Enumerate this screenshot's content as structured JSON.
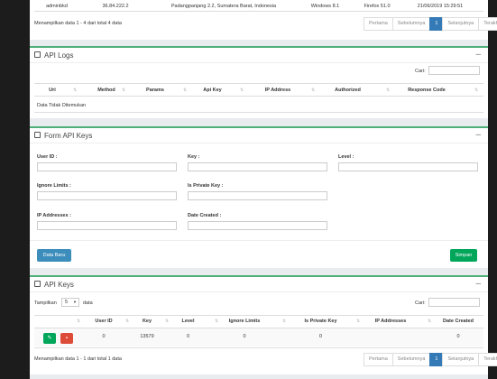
{
  "top_table": {
    "row": [
      "adminbkd",
      "36.84.222.2",
      "Padangpanjang 2.2, Sumatera Barat, Indonesia",
      "Windows 8.1",
      "Firefox 51.0",
      "21/06/2019 15:29:51"
    ],
    "info": "Menampilkan data 1 - 4 dari total 4 data",
    "pagination": {
      "first": "Pertama",
      "prev": "Sebelumnya",
      "current": "1",
      "next": "Selanjutnya",
      "last": "Terakhir"
    }
  },
  "api_logs": {
    "title": "API Logs",
    "collapse": "–",
    "search_label": "Cari:",
    "columns": [
      "Uri",
      "Method",
      "Params",
      "Api Key",
      "IP Address",
      "Authorized",
      "Response Code"
    ],
    "empty": "Data Tidak Ditemukan"
  },
  "form": {
    "title": "Form API Keys",
    "collapse": "–",
    "user_id_label": "User ID :",
    "key_label": "Key :",
    "level_label": "Level :",
    "ignore_limits_label": "Ignore Limits :",
    "private_key_label": "Is Private Key :",
    "ip_label": "IP Addresses :",
    "date_created_label": "Date Created :",
    "new_button": "Data Baru",
    "save_button": "Simpan"
  },
  "api_keys": {
    "title": "API Keys",
    "collapse": "–",
    "show_label": "Tampilkan",
    "show_value": "5",
    "show_suffix": "data",
    "search_label": "Cari:",
    "columns": [
      "",
      "User ID",
      "Key",
      "Level",
      "Ignore Limits",
      "Is Private Key",
      "IP Addresses",
      "Date Created"
    ],
    "row": {
      "user_id": "0",
      "key": "13579",
      "level": "0",
      "ignore_limits": "0",
      "private_key": "0",
      "ip": "",
      "date": "0"
    },
    "info": "Menampilkan data 1 - 1 dari total 1 data",
    "pagination": {
      "first": "Pertama",
      "prev": "Sebelumnya",
      "current": "1",
      "next": "Selanjutnya",
      "last": "Terakhir"
    }
  },
  "colors": {
    "accent": "#4caf78",
    "primary": "#337ab7",
    "success": "#00a65a",
    "danger": "#dd4b39",
    "info": "#3c8dbc"
  }
}
